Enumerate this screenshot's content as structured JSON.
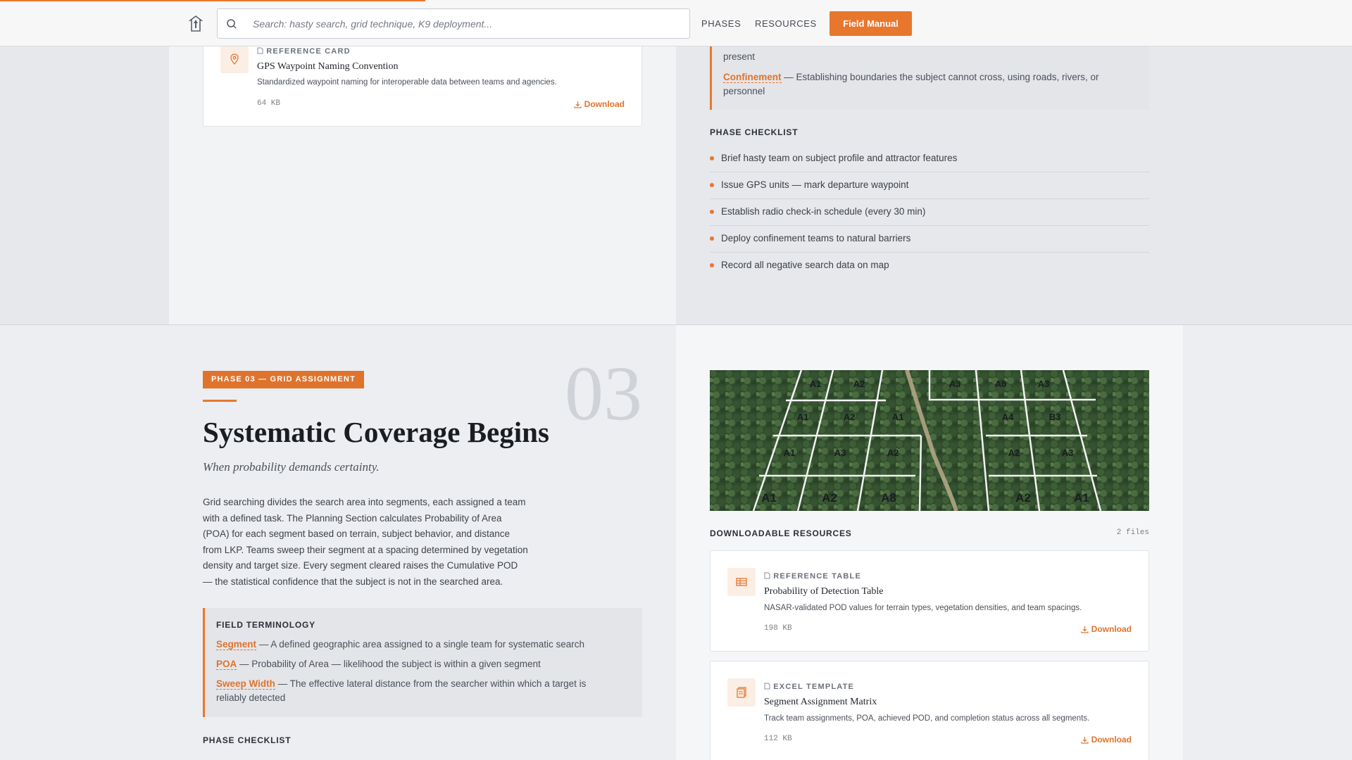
{
  "nav": {
    "search_placeholder": "Search: hasty search, grid technique, K9 deployment...",
    "links": [
      "PHASES",
      "RESOURCES"
    ],
    "cta": "Field Manual"
  },
  "phase02": {
    "card": {
      "type": "REFERENCE CARD",
      "title": "GPS Waypoint Naming Convention",
      "desc": "Standardized waypoint naming for interoperable data between teams and agencies.",
      "size": "64 KB",
      "download": "Download"
    },
    "terminology_partial": {
      "line1_tail": "present",
      "term": "Confinement",
      "def_line1": "— Establishing boundaries the subject cannot cross, using roads, rivers, or",
      "def_line2": "personnel"
    },
    "checklist_label": "PHASE CHECKLIST",
    "checklist": [
      "Brief hasty team on subject profile and attractor features",
      "Issue GPS units — mark departure waypoint",
      "Establish radio check-in schedule (every 30 min)",
      "Deploy confinement teams to natural barriers",
      "Record all negative search data on map"
    ]
  },
  "phase03": {
    "badge": "PHASE 03 — GRID ASSIGNMENT",
    "number": "03",
    "title": "Systematic Coverage Begins",
    "subtitle": "When probability demands certainty.",
    "body": [
      "Grid searching divides the search area into segments, each assigned a team",
      "with a defined task. The Planning Section calculates Probability of Area",
      "(POA) for each segment based on terrain, subject behavior, and distance",
      "from LKP. Teams sweep their segment at a spacing determined by vegetation",
      "density and target size. Every segment cleared raises the Cumulative POD",
      "— the statistical confidence that the subject is not in the searched area."
    ],
    "terminology_label": "FIELD TERMINOLOGY",
    "terms": [
      {
        "term": "Segment",
        "def": "— A defined geographic area assigned to a single team for systematic search"
      },
      {
        "term": "POA",
        "def": "— Probability of Area — likelihood the subject is within a given segment"
      },
      {
        "term": "Sweep Width",
        "def": "— The effective lateral distance from the searcher within which a target is",
        "def2": "reliably detected"
      }
    ],
    "checklist_label": "PHASE CHECKLIST",
    "map_labels": [
      "A1",
      "A2",
      "A3",
      "A8",
      "A3",
      "A1",
      "A2",
      "A1",
      "A4",
      "B3",
      "A1",
      "A3",
      "A2",
      "A2",
      "A3",
      "A1",
      "A2",
      "A8",
      "A2",
      "A1"
    ],
    "resources_label": "DOWNLOADABLE RESOURCES",
    "files_count": "2 files",
    "cards": [
      {
        "type": "REFERENCE TABLE",
        "title": "Probability of Detection Table",
        "desc": "NASAR-validated POD values for terrain types, vegetation densities, and team spacings.",
        "size": "198 KB",
        "download": "Download"
      },
      {
        "type": "EXCEL TEMPLATE",
        "title": "Segment Assignment Matrix",
        "desc": "Track team assignments, POA, achieved POD, and completion status across all segments.",
        "size": "112 KB",
        "download": "Download"
      }
    ]
  },
  "colors": {
    "accent": "#e8772e",
    "forest": "#2f4a2c"
  }
}
